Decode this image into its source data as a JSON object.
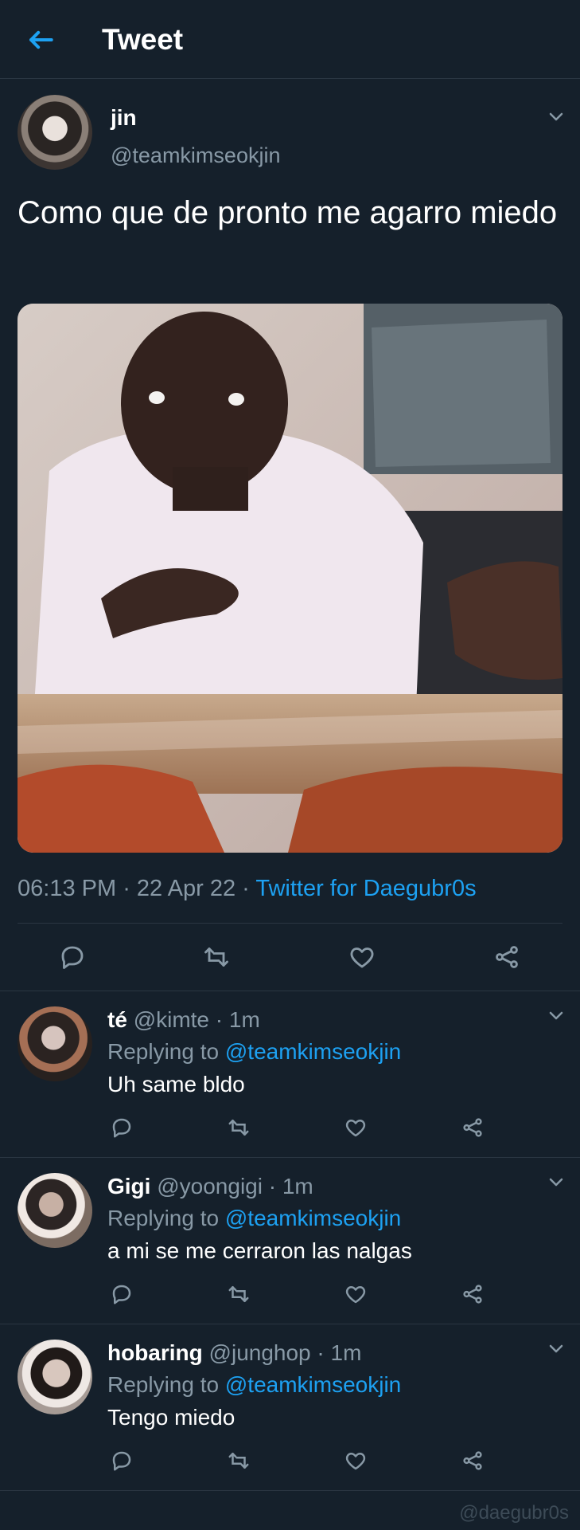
{
  "header": {
    "back_icon": "arrow-left-icon",
    "title": "Tweet",
    "accent_color": "#1da1f2"
  },
  "tweet": {
    "author_name": "jin",
    "author_handle": "@teamkimseokjin",
    "text": "Como que de pronto me agarro miedo",
    "time": "06:13 PM",
    "date": "22 Apr 22",
    "source": "Twitter for Daegubr0s",
    "menu_icon": "chevron-down-icon",
    "actions": [
      "reply-icon",
      "retweet-icon",
      "like-icon",
      "share-icon"
    ]
  },
  "replies": [
    {
      "name": "té",
      "handle": "@kimte",
      "dot": " · ",
      "time": "1m",
      "replying_prefix": "Replying to ",
      "replying_to": "@teamkimseokjin",
      "text": "Uh same bldo"
    },
    {
      "name": "Gigi",
      "handle": "@yoongigi",
      "dot": " · ",
      "time": "1m",
      "replying_prefix": "Replying to ",
      "replying_to": "@teamkimseokjin",
      "text": "a mi se me cerraron las nalgas"
    },
    {
      "name": "hobaring",
      "handle": "@junghop",
      "dot": " · ",
      "time": "1m",
      "replying_prefix": "Replying to ",
      "replying_to": "@teamkimseokjin",
      "text": "Tengo miedo"
    }
  ],
  "watermark": "@daegubr0s",
  "colors": {
    "background": "#15202b",
    "secondary_text": "#8899a6",
    "divider": "#2a3642",
    "link": "#1da1f2"
  }
}
